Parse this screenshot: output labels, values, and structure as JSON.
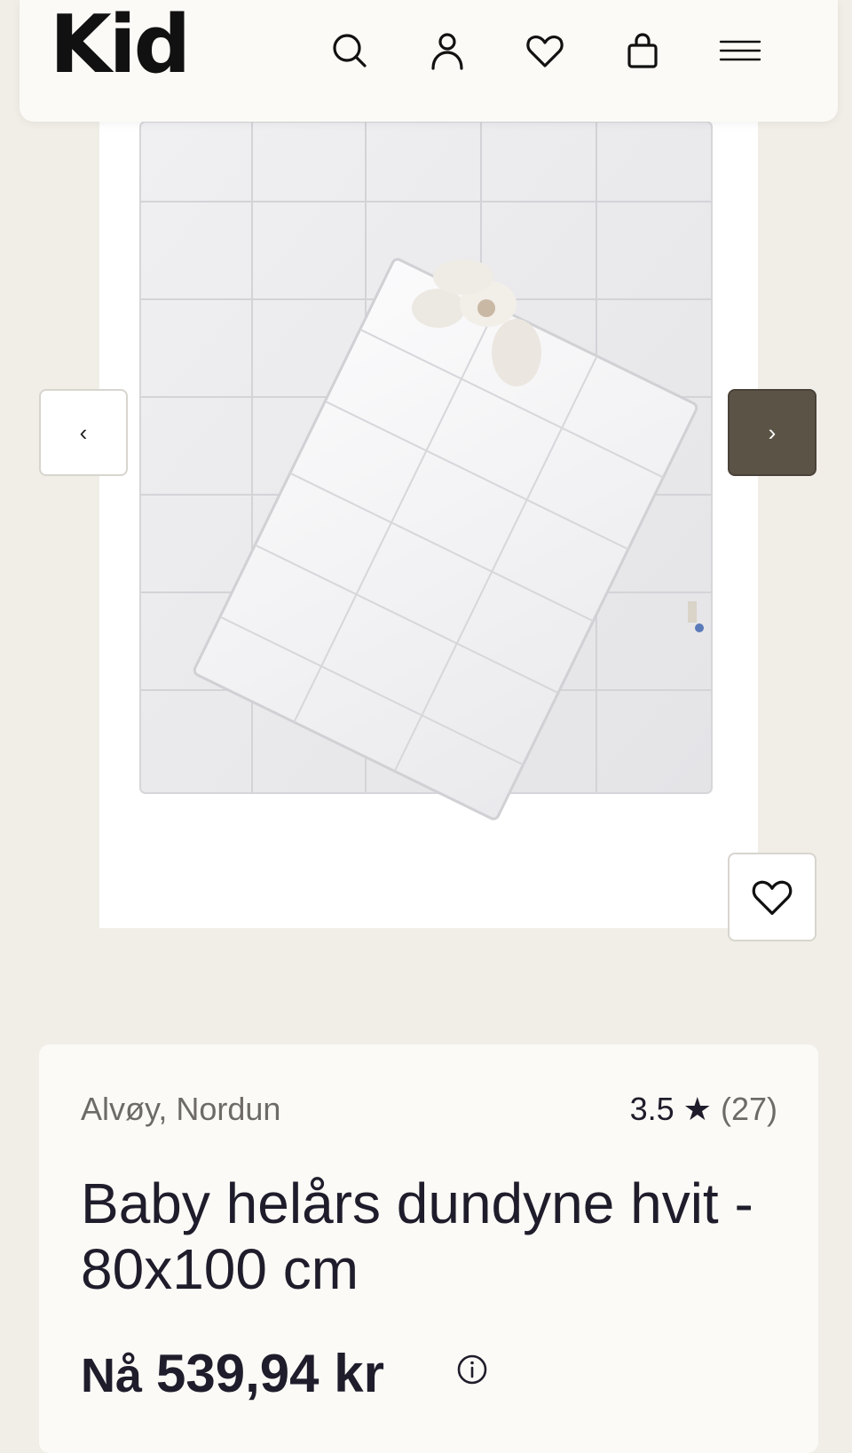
{
  "header": {
    "logo": "Kid",
    "icons": [
      "search-icon",
      "account-icon",
      "heart-icon",
      "bag-icon",
      "menu-icon"
    ]
  },
  "gallery": {
    "prev_glyph": "‹",
    "next_glyph": "›"
  },
  "product": {
    "brand": "Alvøy, Nordun",
    "rating": "3.5",
    "rating_star": "★",
    "review_count": "(27)",
    "title": "Baby helårs dundyne hvit - 80x100 cm",
    "price_prefix": "Nå",
    "price": "539,94 kr"
  },
  "colors": {
    "background": "#f1eee8",
    "card": "#fbfaf6",
    "next_button": "#5c5347",
    "text": "#1f1d2b"
  }
}
